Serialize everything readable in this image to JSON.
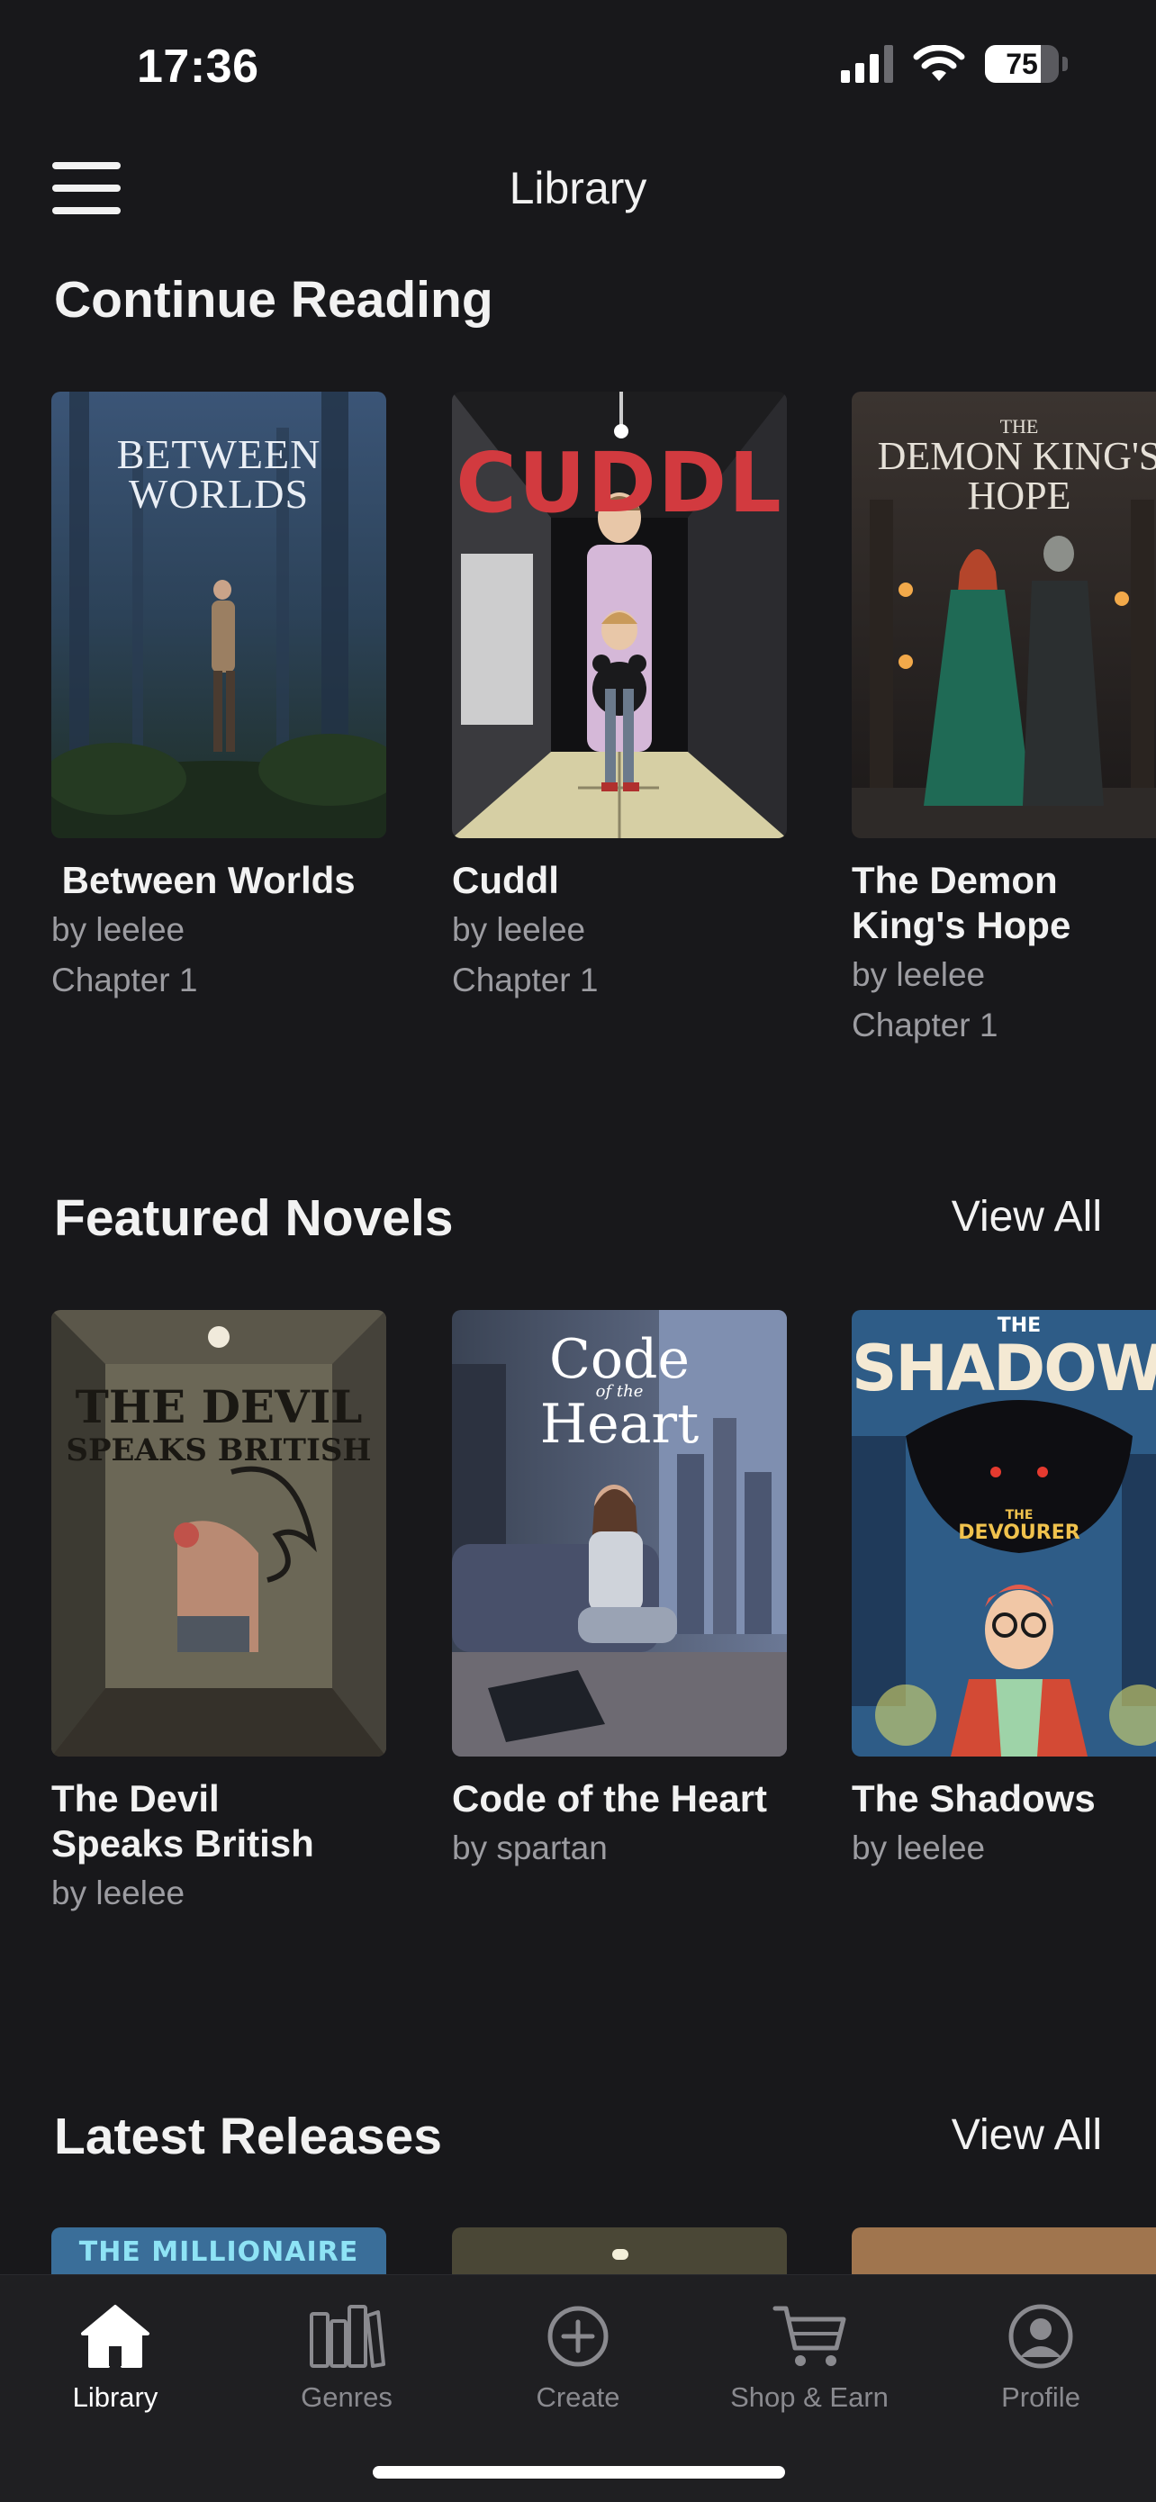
{
  "status_bar": {
    "time": "17:36",
    "battery": "75",
    "battery_level": 0.75
  },
  "header": {
    "title": "Library"
  },
  "continue_reading": {
    "title": "Continue Reading",
    "books": [
      {
        "title": " Between Worlds",
        "author": "by leelee",
        "chapter": "Chapter 1",
        "cover_text": [
          "BETWEEN",
          "WORLDS"
        ]
      },
      {
        "title": "Cuddl",
        "author": "by leelee",
        "chapter": "Chapter 1",
        "cover_text": [
          "CUDDL"
        ]
      },
      {
        "title": "The Demon King's Hope",
        "author": "by leelee",
        "chapter": "Chapter 1",
        "cover_text": [
          "THE",
          "DEMON KING'S",
          "HOPE"
        ]
      }
    ]
  },
  "featured_novels": {
    "title": "Featured Novels",
    "view_all": "View All",
    "books": [
      {
        "title": "The Devil Speaks British",
        "author": "by leelee",
        "cover_text": [
          "THE DEVIL",
          "SPEAKS BRITISH"
        ]
      },
      {
        "title": "Code of the Heart",
        "author": "by spartan",
        "cover_text": [
          "Code",
          "of the",
          "Heart"
        ]
      },
      {
        "title": "The Shadows",
        "author": "by leelee",
        "cover_text": [
          "THE",
          "SHADOWS",
          "THE",
          "DEVOURER"
        ]
      }
    ]
  },
  "latest_releases": {
    "title": "Latest Releases",
    "view_all": "View All",
    "peek_text": "THE MILLIONAIRE"
  },
  "tab_bar": {
    "tabs": [
      {
        "label": "Library",
        "icon": "home-icon",
        "active": true
      },
      {
        "label": "Genres",
        "icon": "books-icon",
        "active": false
      },
      {
        "label": "Create",
        "icon": "plus-circle-icon",
        "active": false
      },
      {
        "label": "Shop & Earn",
        "icon": "cart-icon",
        "active": false
      },
      {
        "label": "Profile",
        "icon": "profile-icon",
        "active": false
      }
    ]
  },
  "colors": {
    "background": "#18181b",
    "tab_bar": "#1f1f22",
    "text_primary": "#f2f2f2",
    "text_secondary": "#9c9ca1",
    "cuddl_red": "#d23a3f"
  }
}
